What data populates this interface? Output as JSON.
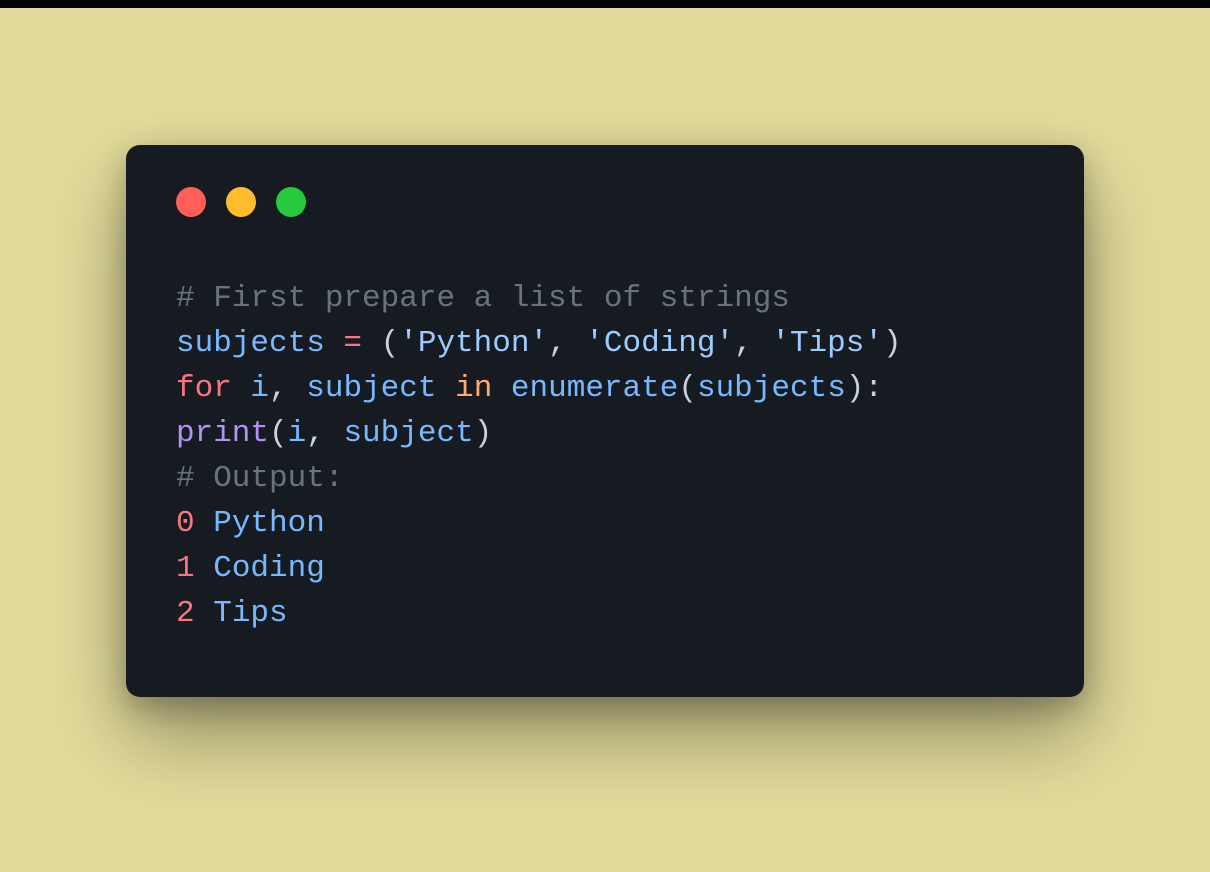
{
  "colors": {
    "background": "#e2db9b",
    "window": "#161b22",
    "traffic_red": "#ff5f56",
    "traffic_yellow": "#ffbd2e",
    "traffic_green": "#27c93f"
  },
  "code": {
    "l1_comment": "# First prepare a list of strings",
    "l2": {
      "var": "subjects",
      "eq": " = ",
      "lp": "(",
      "s1": "'Python'",
      "c1": ", ",
      "s2": "'Coding'",
      "c2": ", ",
      "s3": "'Tips'",
      "rp": ")"
    },
    "l3": {
      "for": "for",
      "sp1": " ",
      "i": "i",
      "comma": ", ",
      "subject": "subject",
      "sp2": " ",
      "in": "in",
      "sp3": " ",
      "enumerate": "enumerate",
      "lp": "(",
      "arg": "subjects",
      "rp": ")",
      "colon": ":"
    },
    "l4": {
      "print": "print",
      "lp": "(",
      "i": "i",
      "comma": ", ",
      "subject": "subject",
      "rp": ")"
    },
    "l5_comment": "# Output:",
    "out": [
      {
        "n": "0",
        "t": "Python"
      },
      {
        "n": "1",
        "t": "Coding"
      },
      {
        "n": "2",
        "t": "Tips"
      }
    ]
  }
}
